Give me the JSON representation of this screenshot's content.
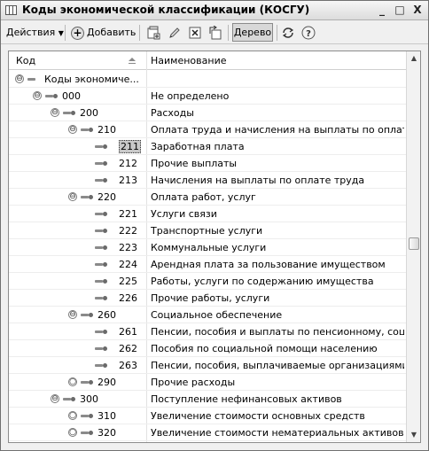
{
  "window": {
    "title": "Коды экономической классификации (КОСГУ)",
    "buttons": [
      "_",
      "□",
      "X"
    ]
  },
  "toolbar": {
    "actions_label": "Действия",
    "add_label": "Добавить",
    "tree_label": "Дерево"
  },
  "grid": {
    "col_code": "Код",
    "col_name": "Наименование",
    "rows": [
      {
        "code": "Коды экономиче...",
        "name": "",
        "level": 0,
        "toggle": "⊖"
      },
      {
        "code": "000",
        "name": "Не определено",
        "level": 1,
        "toggle": "⊖"
      },
      {
        "code": "200",
        "name": "Расходы",
        "level": 2,
        "toggle": "⊖"
      },
      {
        "code": "210",
        "name": "Оплата труда и начисления на выплаты по оплате тру...",
        "level": 3,
        "toggle": "⊖"
      },
      {
        "code": "211",
        "name": "Заработная плата",
        "level": 4,
        "toggle": "",
        "selected": true
      },
      {
        "code": "212",
        "name": "Прочие выплаты",
        "level": 4,
        "toggle": ""
      },
      {
        "code": "213",
        "name": "Начисления на выплаты по оплате труда",
        "level": 4,
        "toggle": ""
      },
      {
        "code": "220",
        "name": "Оплата работ, услуг",
        "level": 3,
        "toggle": "⊖"
      },
      {
        "code": "221",
        "name": "Услуги связи",
        "level": 4,
        "toggle": ""
      },
      {
        "code": "222",
        "name": "Транспортные услуги",
        "level": 4,
        "toggle": ""
      },
      {
        "code": "223",
        "name": "Коммунальные услуги",
        "level": 4,
        "toggle": ""
      },
      {
        "code": "224",
        "name": "Арендная плата за пользование имуществом",
        "level": 4,
        "toggle": ""
      },
      {
        "code": "225",
        "name": "Работы, услуги по содержанию имущества",
        "level": 4,
        "toggle": ""
      },
      {
        "code": "226",
        "name": "Прочие работы, услуги",
        "level": 4,
        "toggle": ""
      },
      {
        "code": "260",
        "name": "Социальное обеспечение",
        "level": 3,
        "toggle": "⊖"
      },
      {
        "code": "261",
        "name": "Пенсии, пособия и выплаты по пенсионному, социаль...",
        "level": 4,
        "toggle": ""
      },
      {
        "code": "262",
        "name": "Пособия по социальной помощи населению",
        "level": 4,
        "toggle": ""
      },
      {
        "code": "263",
        "name": "Пенсии, пособия, выплачиваемые организациями се...",
        "level": 4,
        "toggle": ""
      },
      {
        "code": "290",
        "name": "Прочие расходы",
        "level": 3,
        "toggle": "○"
      },
      {
        "code": "300",
        "name": "Поступление нефинансовых активов",
        "level": 2,
        "toggle": "⊖"
      },
      {
        "code": "310",
        "name": "Увеличение стоимости основных средств",
        "level": 3,
        "toggle": "○"
      },
      {
        "code": "320",
        "name": "Увеличение стоимости нематериальных активов",
        "level": 3,
        "toggle": "○"
      }
    ]
  }
}
